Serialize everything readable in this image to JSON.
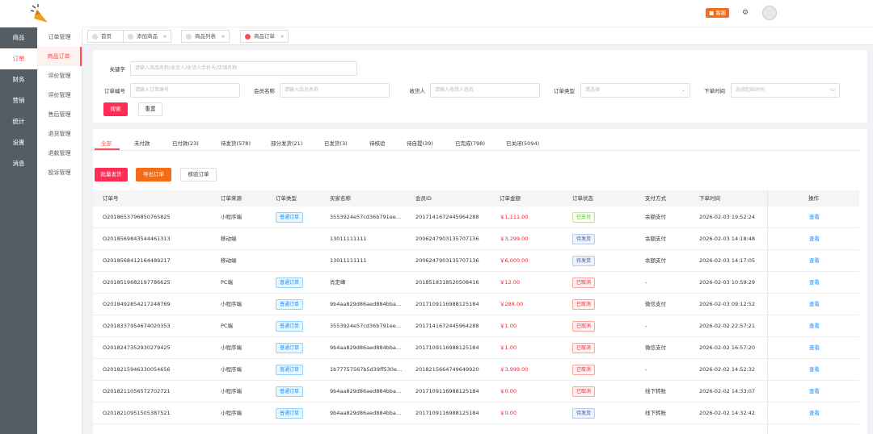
{
  "nav": [
    "商品",
    "订单",
    "财务",
    "营销",
    "统计",
    "设置",
    "消息"
  ],
  "subnav": [
    "订单管理",
    "商品订单",
    "评价管理",
    "评价管理",
    "售后管理",
    "退货管理",
    "退款管理",
    "投诉管理"
  ],
  "header": {
    "badge": "客服"
  },
  "tabs": [
    {
      "label": "首页",
      "closable": false
    },
    {
      "label": "添加商品",
      "closable": true
    },
    {
      "label": "商品列表",
      "closable": true
    },
    {
      "label": "商品订单",
      "closable": true
    }
  ],
  "filters": {
    "keyword": {
      "label": "关键字",
      "placeholder": "请输入商品名称/收货人/收货人手机号/店铺名称"
    },
    "order_no": {
      "label": "订单编号",
      "placeholder": "请输入订单编号"
    },
    "member": {
      "label": "会员名称",
      "placeholder": "请输入会员名称"
    },
    "receiver": {
      "label": "收货人",
      "placeholder": "请输入收货人姓名"
    },
    "type": {
      "label": "订单类型",
      "placeholder": "请选择"
    },
    "time": {
      "label": "下单时间",
      "placeholder": "选择起始时间"
    },
    "search": "搜索",
    "reset": "重置"
  },
  "status_tabs": [
    "全部",
    "未付款",
    "已付款(23)",
    "待发货(578)",
    "部分发货(21)",
    "已发货(3)",
    "待核验",
    "待自提(39)",
    "已完成(798)",
    "已关闭(5094)"
  ],
  "actions": {
    "batch_ship": "批量发货",
    "export": "导出订单",
    "verify": "核验订单"
  },
  "columns": [
    "订单号",
    "订单来源",
    "订单类型",
    "买家名称",
    "会员ID",
    "订单金额",
    "订单状态",
    "支付方式",
    "下单时间",
    "操作"
  ],
  "rows": [
    {
      "id": "O20186537968507658​25",
      "src": "小程序端",
      "type": "普通订单",
      "buyer": "3553924e57cd36b791ee7e86ac0ef9d6",
      "mid": "2017141672445964288",
      "amt": "￥1,111.00",
      "status": "已支付",
      "sc": "green",
      "pay": "余额支付",
      "time": "2026-02-03 19:52:24",
      "op": "查看"
    },
    {
      "id": "O20185698435444613​13",
      "src": "移动端",
      "type": "",
      "buyer": "13011111111",
      "mid": "2006247903135707136",
      "amt": "￥3,299.00",
      "status": "待发货",
      "sc": "ld",
      "pay": "余额支付",
      "time": "2026-02-03 14:18:48",
      "op": "查看"
    },
    {
      "id": "O20185684121644892​17",
      "src": "移动端",
      "type": "",
      "buyer": "13011111111",
      "mid": "2006247903135707136",
      "amt": "￥6,000.00",
      "status": "待发货",
      "sc": "ld",
      "pay": "余额支付",
      "time": "2026-02-03 14:17:05",
      "op": "查看"
    },
    {
      "id": "O20185196821977866​25",
      "src": "PC端",
      "type": "普通订单",
      "buyer": "肖定峰",
      "mid": "2018518318520508416",
      "amt": "￥12.00",
      "status": "已取消",
      "sc": "red",
      "pay": "-",
      "time": "2026-02-03 10:59:29",
      "op": "查看"
    },
    {
      "id": "O20184928542172487​69",
      "src": "小程序端",
      "type": "普通订单",
      "buyer": "9b4aa829d86aed884bba8a7c2d0e4f51",
      "mid": "2017109116988125184",
      "amt": "￥288.00",
      "status": "已取消",
      "sc": "red",
      "pay": "微信支付",
      "time": "2026-02-03 09:12:52",
      "op": "查看"
    },
    {
      "id": "O20183379546740203​53",
      "src": "PC端",
      "type": "普通订单",
      "buyer": "3553924e57cd36b791ee7e86ac0ef9d6",
      "mid": "2017141672445964288",
      "amt": "￥1.00",
      "status": "已取消",
      "sc": "red",
      "pay": "-",
      "time": "2026-02-02 22:57:21",
      "op": "查看"
    },
    {
      "id": "O20182473529302794​25",
      "src": "小程序端",
      "type": "普通订单",
      "buyer": "9b4aa829d86aed884bba8a7c2d0e4f51",
      "mid": "2017109116988125184",
      "amt": "￥1.00",
      "status": "已取消",
      "sc": "red",
      "pay": "微信支付",
      "time": "2026-02-02 16:57:20",
      "op": "查看"
    },
    {
      "id": "O20182159463300546​56",
      "src": "小程序端",
      "type": "普通订单",
      "buyer": "1b77757567b5d39ff530e1ab4c9d2e07",
      "mid": "2018215664749649920",
      "amt": "￥3,999.00",
      "status": "已取消",
      "sc": "red",
      "pay": "-",
      "time": "2026-02-02 14:52:32",
      "op": "查看"
    },
    {
      "id": "O20182110565727027​21",
      "src": "小程序端",
      "type": "普通订单",
      "buyer": "9b4aa829d86aed884bba8a7c2d0e4f51",
      "mid": "2017109116988125184",
      "amt": "￥0.00",
      "status": "已取消",
      "sc": "red",
      "pay": "线下转账",
      "time": "2026-02-02 14:33:07",
      "op": "查看"
    },
    {
      "id": "O20182109515053875​21",
      "src": "小程序端",
      "type": "普通订单",
      "buyer": "9b4aa829d86aed884bba8a7c2d0e4f51",
      "mid": "2017109116988125184",
      "amt": "￥0.00",
      "status": "待发货",
      "sc": "ld",
      "pay": "线下转账",
      "time": "2026-02-02 14:32:42",
      "op": "查看"
    }
  ]
}
